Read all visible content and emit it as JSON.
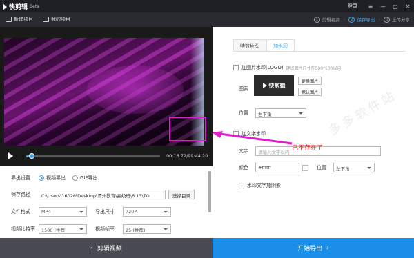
{
  "titlebar": {
    "app_name": "快剪辑",
    "app_beta": "Beta",
    "login": "登录",
    "menu_icon": "menu-icon",
    "minimize_icon": "minimize-icon",
    "maximize_icon": "maximize-icon",
    "close_icon": "close-icon"
  },
  "toolbar": {
    "new_project": "新建项目",
    "my_projects": "我的项目",
    "steps": [
      {
        "num": "1",
        "label": "剪辑视频"
      },
      {
        "num": "2",
        "label": "保存导出"
      },
      {
        "num": "3",
        "label": "上传分享"
      }
    ]
  },
  "player": {
    "time": "00:16.72/99:44.20",
    "progress": 0.04
  },
  "export": {
    "settings_label": "导出设置",
    "opt_video": "视频导出",
    "opt_gif": "GIF导出",
    "path_label": "保存路径",
    "path_value": "C:\\Users\\16026\\Desktop\\潭州教育\\高级班\\6.13\\TO",
    "browse_btn": "选择目录",
    "format_label": "文件格式",
    "format_value": "MP4",
    "size_label": "导出尺寸",
    "size_value": "720P",
    "bitrate_label": "视频比特率",
    "bitrate_value": "1500 (推荐)",
    "fps_label": "视频帧率",
    "fps_value": "25 (推荐)"
  },
  "right": {
    "tab_effects": "特效片头",
    "tab_watermark": "加水印",
    "img_wm_label": "加图片水印(LOGO)",
    "img_wm_hint": "建议图片尺寸在500*500以内",
    "pattern_label": "图案",
    "logo_text": "快剪辑",
    "change_img_btn": "更换图片",
    "default_img_btn": "默认图片",
    "position_label": "位置",
    "position_value": "右下角",
    "text_wm_label": "加文字水印",
    "text_label": "文字",
    "text_placeholder": "请输入文字以内",
    "color_label": "颜色",
    "color_value": "#ffffff",
    "text_position_label": "位置",
    "text_position_value": "左下角",
    "shadow_label": "水印文字加阴影",
    "annotation": "已不存在了"
  },
  "bottom": {
    "back_btn": "剪辑视频",
    "export_btn": "开始导出"
  },
  "site_watermark": "多多软件站",
  "colors": {
    "accent": "#3fa9f5",
    "export_button": "#1a8ee8",
    "annotation": "#e21a1a",
    "highlight_box": "#e01ed0"
  }
}
